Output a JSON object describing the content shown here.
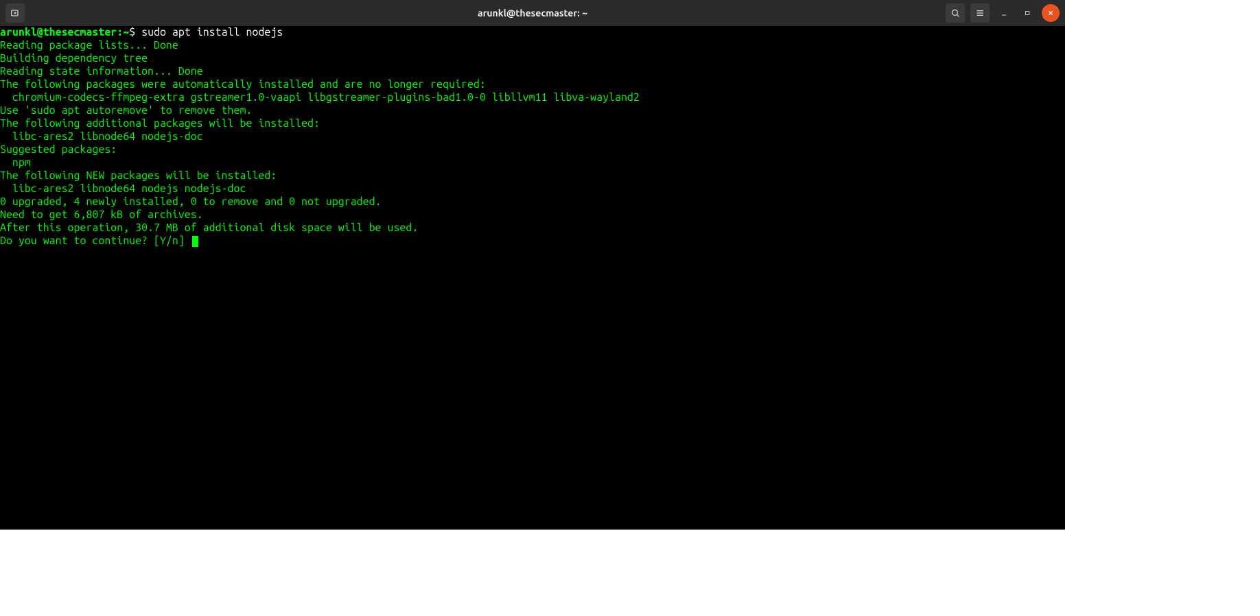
{
  "titlebar": {
    "title": "arunkl@thesecmaster: ~"
  },
  "prompt": {
    "user_host": "arunkl@thesecmaster",
    "path": "~",
    "symbol": "$",
    "command": "sudo apt install nodejs"
  },
  "output": [
    "Reading package lists... Done",
    "Building dependency tree",
    "Reading state information... Done",
    "The following packages were automatically installed and are no longer required:",
    "  chromium-codecs-ffmpeg-extra gstreamer1.0-vaapi libgstreamer-plugins-bad1.0-0 libllvm11 libva-wayland2",
    "Use 'sudo apt autoremove' to remove them.",
    "The following additional packages will be installed:",
    "  libc-ares2 libnode64 nodejs-doc",
    "Suggested packages:",
    "  npm",
    "The following NEW packages will be installed:",
    "  libc-ares2 libnode64 nodejs nodejs-doc",
    "0 upgraded, 4 newly installed, 0 to remove and 0 not upgraded.",
    "Need to get 6,807 kB of archives.",
    "After this operation, 30.7 MB of additional disk space will be used.",
    "Do you want to continue? [Y/n] "
  ]
}
